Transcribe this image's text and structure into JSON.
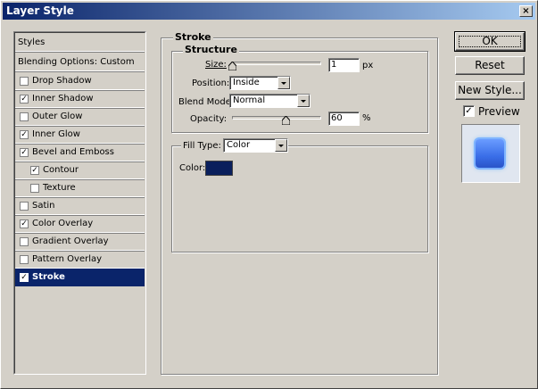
{
  "window": {
    "title": "Layer Style",
    "close_glyph": "×"
  },
  "sidebar": {
    "header_styles": "Styles",
    "header_blending": "Blending Options: Custom",
    "items": [
      {
        "label": "Drop Shadow",
        "checked": false
      },
      {
        "label": "Inner Shadow",
        "checked": true
      },
      {
        "label": "Outer Glow",
        "checked": false
      },
      {
        "label": "Inner Glow",
        "checked": true
      },
      {
        "label": "Bevel and Emboss",
        "checked": true
      },
      {
        "label": "Contour",
        "checked": true
      },
      {
        "label": "Texture",
        "checked": false
      },
      {
        "label": "Satin",
        "checked": false
      },
      {
        "label": "Color Overlay",
        "checked": true
      },
      {
        "label": "Gradient Overlay",
        "checked": false
      },
      {
        "label": "Pattern Overlay",
        "checked": false
      },
      {
        "label": "Stroke",
        "checked": true
      }
    ]
  },
  "stroke": {
    "title": "Stroke",
    "structure_title": "Structure",
    "size_label": "Size:",
    "size_value": "1",
    "size_unit": "px",
    "position_label": "Position:",
    "position_value": "Inside",
    "blend_label": "Blend Mode:",
    "blend_value": "Normal",
    "opacity_label": "Opacity:",
    "opacity_value": "60",
    "opacity_unit": "%",
    "filltype_label": "Fill Type:",
    "filltype_value": "Color",
    "color_label": "Color:",
    "color_value": "#0a1f5c"
  },
  "buttons": {
    "ok": "OK",
    "reset": "Reset",
    "new_style": "New Style...",
    "preview": "Preview",
    "preview_checked": true
  },
  "colors": {
    "titlebar_start": "#0a246a",
    "titlebar_end": "#a6caf0",
    "selection": "#0a246a",
    "preview_blue": "#3a6ee8"
  },
  "checkmark": "✓"
}
